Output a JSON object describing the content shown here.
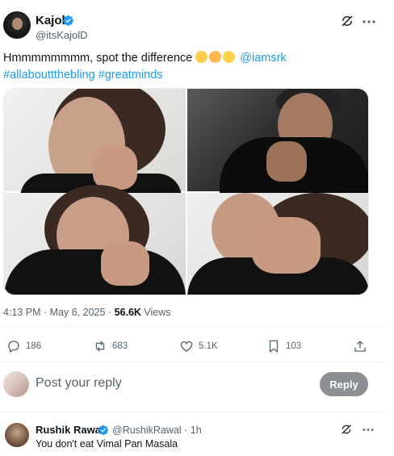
{
  "author": {
    "name": "Kajol",
    "handle": "@itsKajolD"
  },
  "tweet": {
    "text_main": "Hmmmmmmmm, spot the difference",
    "emojis": [
      "monocle-face-emoji",
      "winking-tongue-emoji",
      "rofl-emoji"
    ],
    "mention": "@iamsrk",
    "hashtag_1": "#allabouttthebling",
    "hashtag_2": "#greatminds"
  },
  "meta": {
    "time_date": "4:13 PM · May 6, 2025 · ",
    "views_count": "56.6K",
    "views_label": " Views"
  },
  "actions": {
    "replies": "186",
    "reposts": "683",
    "likes": "5.1K",
    "bookmarks": "103"
  },
  "reply_box": {
    "placeholder": "Post your reply",
    "button_label": "Reply"
  },
  "comment": {
    "name": "Rushik Rawal",
    "handle_time": "@RushikRawal · 1h",
    "text": "You don't eat Vimal Pan Masala"
  },
  "colors": {
    "link": "#1d9bf0",
    "verified": "#1d9bf0",
    "muted": "#536471"
  }
}
